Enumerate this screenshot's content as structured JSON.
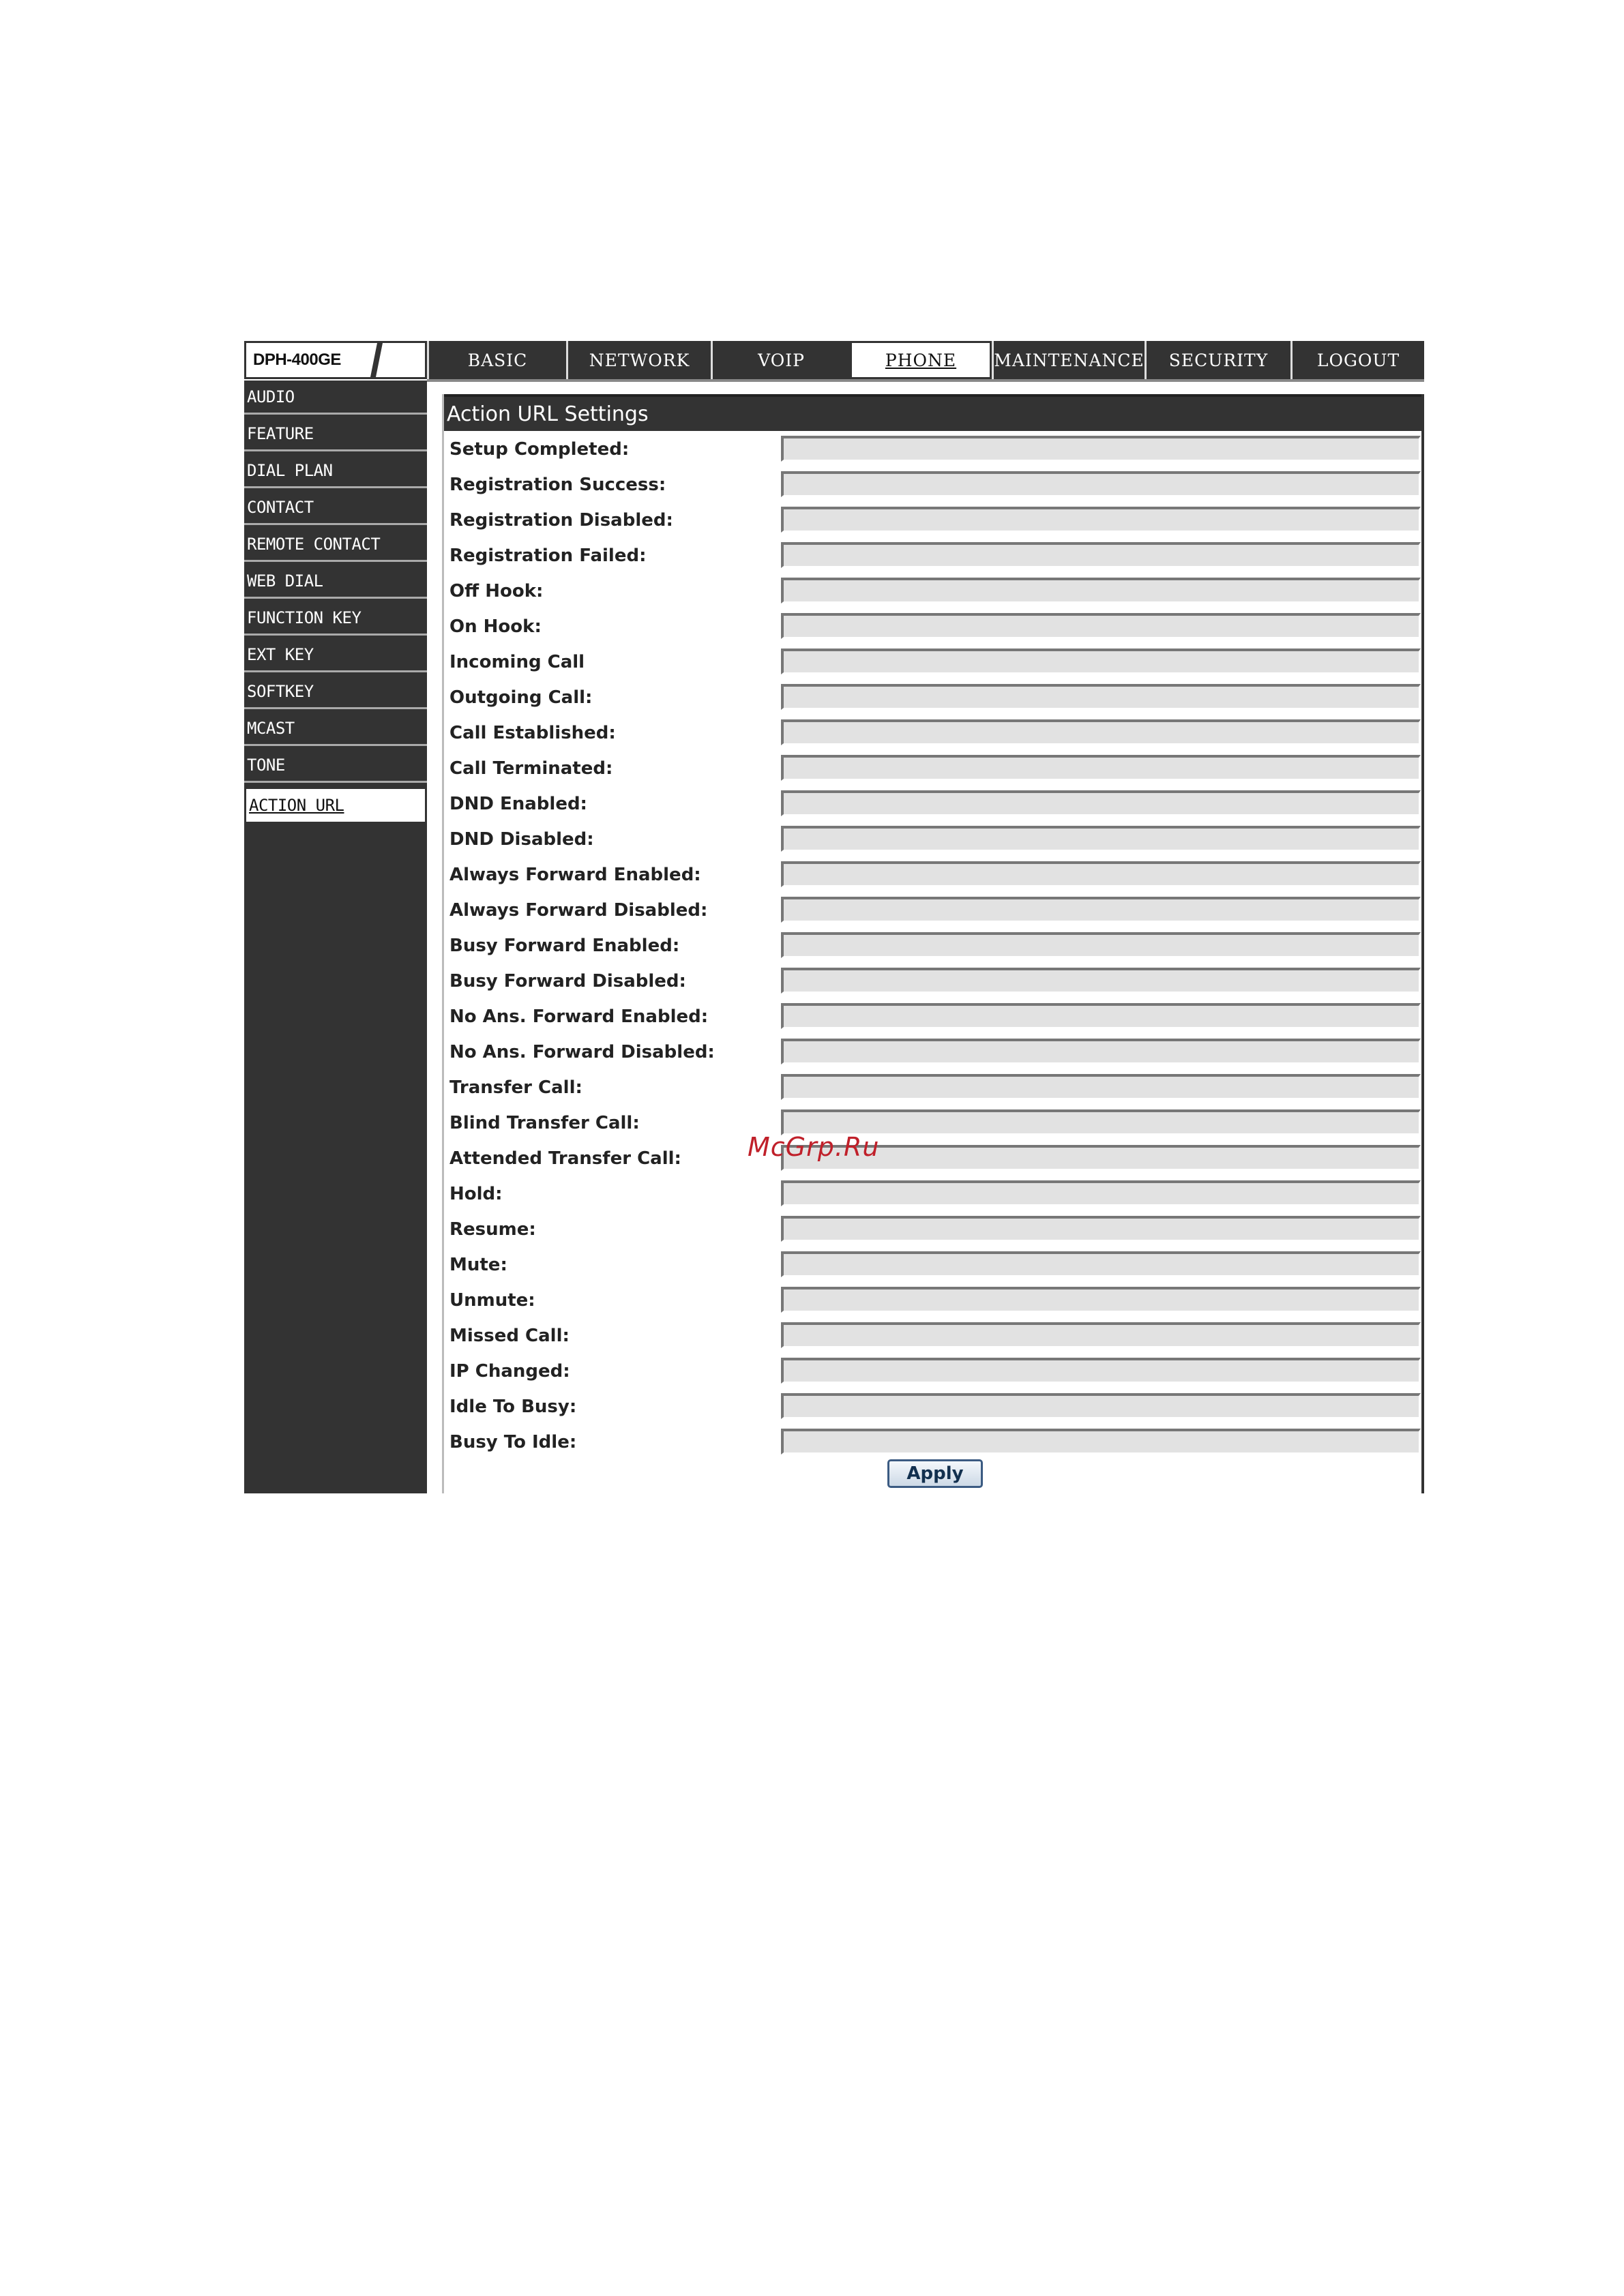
{
  "header": {
    "logo_text": "DPH-400GE",
    "tabs": [
      {
        "label": "BASIC"
      },
      {
        "label": "NETWORK"
      },
      {
        "label": "VOIP"
      },
      {
        "label": "PHONE",
        "active": true
      },
      {
        "label": "MAINTENANCE"
      },
      {
        "label": "SECURITY"
      },
      {
        "label": "LOGOUT"
      }
    ]
  },
  "sidebar": {
    "items": [
      {
        "label": "AUDIO"
      },
      {
        "label": "FEATURE"
      },
      {
        "label": "DIAL PLAN"
      },
      {
        "label": "CONTACT"
      },
      {
        "label": "REMOTE CONTACT"
      },
      {
        "label": "WEB DIAL"
      },
      {
        "label": "FUNCTION KEY"
      },
      {
        "label": "EXT KEY"
      },
      {
        "label": "SOFTKEY"
      },
      {
        "label": "MCAST"
      },
      {
        "label": "TONE"
      },
      {
        "label": "ACTION URL",
        "active": true
      }
    ]
  },
  "main": {
    "title": "Action URL Settings",
    "fields": [
      {
        "label": "Setup Completed:",
        "value": ""
      },
      {
        "label": "Registration Success:",
        "value": ""
      },
      {
        "label": "Registration Disabled:",
        "value": ""
      },
      {
        "label": "Registration Failed:",
        "value": ""
      },
      {
        "label": "Off Hook:",
        "value": ""
      },
      {
        "label": "On Hook:",
        "value": ""
      },
      {
        "label": "Incoming Call",
        "value": ""
      },
      {
        "label": "Outgoing Call:",
        "value": ""
      },
      {
        "label": "Call Established:",
        "value": ""
      },
      {
        "label": "Call Terminated:",
        "value": ""
      },
      {
        "label": "DND Enabled:",
        "value": ""
      },
      {
        "label": "DND Disabled:",
        "value": ""
      },
      {
        "label": "Always Forward Enabled:",
        "value": ""
      },
      {
        "label": "Always Forward Disabled:",
        "value": ""
      },
      {
        "label": "Busy Forward Enabled:",
        "value": ""
      },
      {
        "label": "Busy Forward Disabled:",
        "value": ""
      },
      {
        "label": "No Ans. Forward Enabled:",
        "value": ""
      },
      {
        "label": "No Ans. Forward Disabled:",
        "value": ""
      },
      {
        "label": "Transfer Call:",
        "value": ""
      },
      {
        "label": "Blind Transfer Call:",
        "value": ""
      },
      {
        "label": "Attended Transfer Call:",
        "value": ""
      },
      {
        "label": "Hold:",
        "value": ""
      },
      {
        "label": "Resume:",
        "value": ""
      },
      {
        "label": "Mute:",
        "value": ""
      },
      {
        "label": "Unmute:",
        "value": ""
      },
      {
        "label": "Missed Call:",
        "value": ""
      },
      {
        "label": "IP Changed:",
        "value": ""
      },
      {
        "label": "Idle To Busy:",
        "value": ""
      },
      {
        "label": "Busy To Idle:",
        "value": ""
      }
    ],
    "apply_label": "Apply"
  },
  "watermark": "McGrp.Ru"
}
